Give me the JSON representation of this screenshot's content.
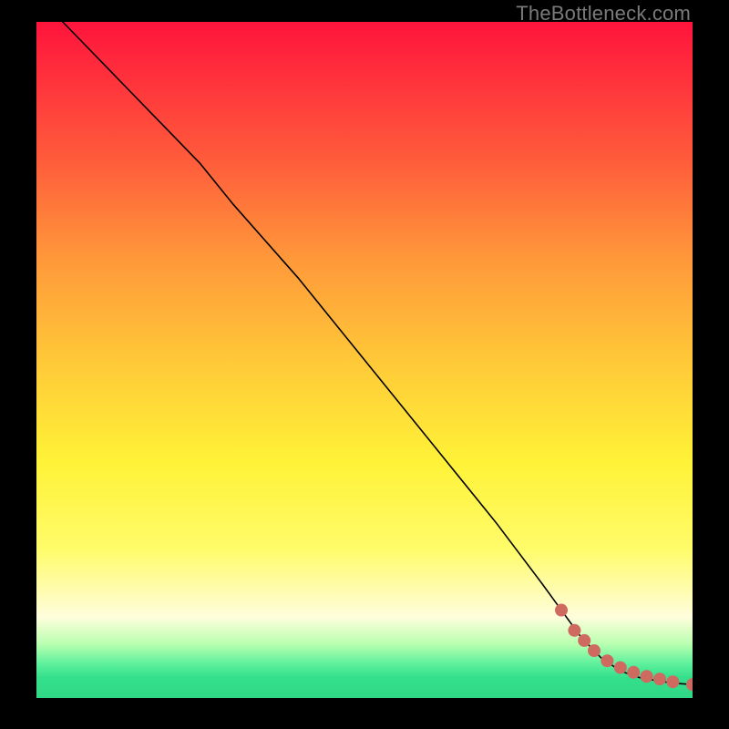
{
  "watermark": "TheBottleneck.com",
  "chart_data": {
    "type": "line",
    "title": "",
    "xlabel": "",
    "ylabel": "",
    "xlim": [
      0,
      100
    ],
    "ylim": [
      0,
      100
    ],
    "grid": false,
    "legend": false,
    "background_gradient": {
      "direction": "vertical",
      "stops": [
        {
          "pos": 0,
          "color": "#ff143c"
        },
        {
          "pos": 50,
          "color": "#ffe037"
        },
        {
          "pos": 88,
          "color": "#fffddc"
        },
        {
          "pos": 100,
          "color": "#2fd886"
        }
      ]
    },
    "series": [
      {
        "name": "curve",
        "style": "line",
        "color": "#000000",
        "x": [
          4,
          12,
          20,
          25,
          30,
          40,
          50,
          60,
          70,
          77,
          80,
          83,
          86,
          89,
          92,
          95,
          97,
          100
        ],
        "y": [
          100,
          92,
          84,
          79,
          73,
          62,
          50,
          38,
          26,
          17,
          13,
          9,
          6,
          4,
          3,
          2.5,
          2.2,
          2
        ]
      },
      {
        "name": "points",
        "style": "scatter",
        "marker": "circle",
        "color": "#cf6a61",
        "x": [
          80,
          82,
          83.5,
          85,
          87,
          89,
          91,
          93,
          95,
          97,
          100
        ],
        "y": [
          13,
          10,
          8.5,
          7,
          5.5,
          4.5,
          3.8,
          3.2,
          2.8,
          2.4,
          2
        ]
      }
    ]
  }
}
